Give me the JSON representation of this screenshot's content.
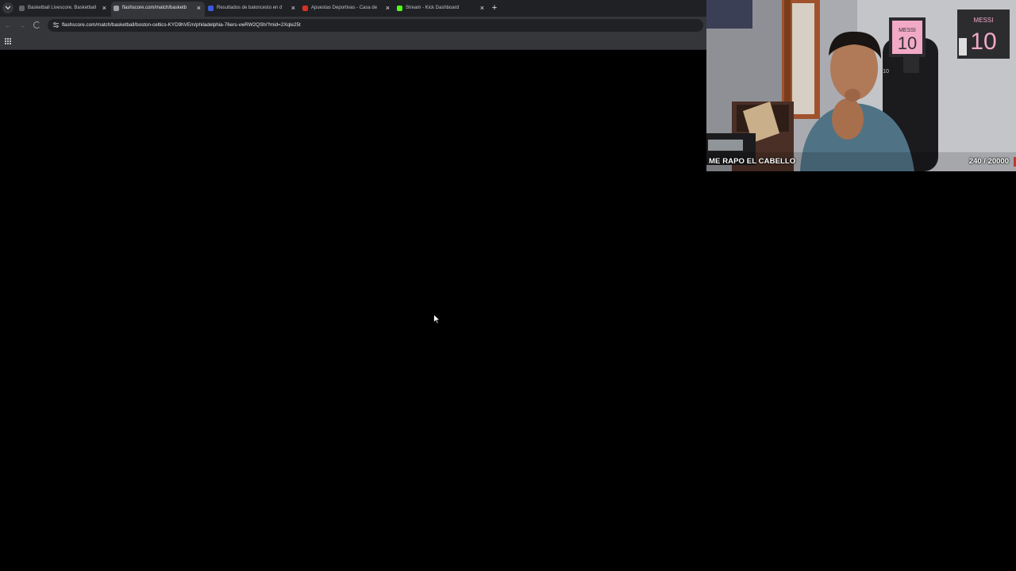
{
  "browser": {
    "tabs": [
      {
        "title": "Basketball Livescore, Basketball",
        "favicon_color": "#5f6368",
        "active": false
      },
      {
        "title": "flashscore.com/match/basketb",
        "favicon_color": "#9aa0a6",
        "active": true
      },
      {
        "title": "Resultados de baloncesto en d",
        "favicon_color": "#3b5bdb",
        "active": false
      },
      {
        "title": "Apuestas Deportivas - Casa de",
        "favicon_color": "#d93025",
        "active": false
      },
      {
        "title": "Stream - Kick Dashboard",
        "favicon_color": "#53fc18",
        "active": false
      }
    ],
    "close_glyph": "×",
    "new_tab_glyph": "+",
    "address_bar": {
      "url": "flashscore.com/match/basketball/boston-celtics-KYD9hVEm/philadelphia-76ers-vwRW2QSh/?mid=2Xqle25t"
    },
    "page_loading": true
  },
  "webcam": {
    "title": "ME RAPO EL CABELLO",
    "counter": "240 / 20000",
    "poster_text_1": "MESSI",
    "poster_number_1": "10",
    "poster_text_2": "MESSI",
    "poster_number_2": "10",
    "chair_number": "10"
  },
  "icons": {
    "tab_search": "chevron-down-icon",
    "back": "arrow-left-icon",
    "forward": "arrow-right-icon",
    "reload": "loading-spinner-icon",
    "site_info": "tune-icon",
    "apps": "apps-grid-icon",
    "cursor": "mouse-cursor-icon"
  }
}
